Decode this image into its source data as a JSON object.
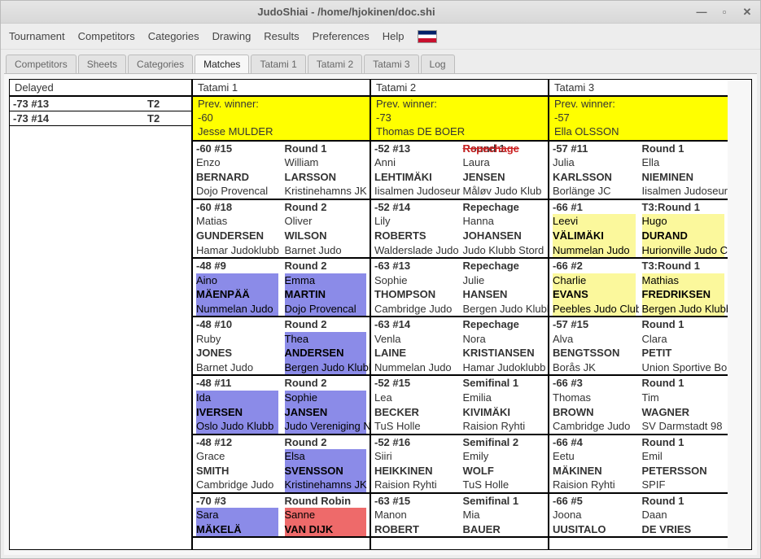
{
  "window": {
    "title": "JudoShiai - /home/hjokinen/doc.shi"
  },
  "menu": [
    "Tournament",
    "Competitors",
    "Categories",
    "Drawing",
    "Results",
    "Preferences",
    "Help"
  ],
  "tabs": [
    "Competitors",
    "Sheets",
    "Categories",
    "Matches",
    "Tatami 1",
    "Tatami 2",
    "Tatami 3",
    "Log"
  ],
  "active_tab": "Matches",
  "headers": {
    "delayed": "Delayed",
    "t1": "Tatami 1",
    "t2": "Tatami 2",
    "t3": "Tatami 3"
  },
  "delayed": [
    {
      "cat": "-73 #13",
      "tatami": "T2"
    },
    {
      "cat": "-73 #14",
      "tatami": "T2"
    }
  ],
  "prev": {
    "label": "Prev. winner:",
    "t1": {
      "cat": "-60",
      "name": "Jesse MULDER"
    },
    "t2": {
      "cat": "-73",
      "name": "Thomas DE BOER"
    },
    "t3": {
      "cat": "-57",
      "name": "Ella OLSSON"
    }
  },
  "t1": [
    {
      "cat": "-60 #15",
      "round": "Round 1",
      "white": {
        "given": "Enzo",
        "family": "BERNARD",
        "club": "Dojo Provencal"
      },
      "blue": {
        "given": "William",
        "family": "LARSSON",
        "club": "Kristinehamns JK"
      }
    },
    {
      "cat": "-60 #18",
      "round": "Round 2",
      "white": {
        "given": "Matias",
        "family": "GUNDERSEN",
        "club": "Hamar Judoklubb"
      },
      "blue": {
        "given": "Oliver",
        "family": "WILSON",
        "club": "Barnet Judo"
      }
    },
    {
      "cat": "-48 #9",
      "round": "Round 2",
      "white": {
        "given": "Aino",
        "family": "MÄENPÄÄ",
        "club": "Nummelan Judo",
        "hl": "blue"
      },
      "blue": {
        "given": "Emma",
        "family": "MARTIN",
        "club": "Dojo Provencal",
        "hl": "blue"
      }
    },
    {
      "cat": "-48 #10",
      "round": "Round 2",
      "white": {
        "given": "Ruby",
        "family": "JONES",
        "club": "Barnet Judo"
      },
      "blue": {
        "given": "Thea",
        "family": "ANDERSEN",
        "club": "Bergen Judo Klubb",
        "hl": "blue"
      }
    },
    {
      "cat": "-48 #11",
      "round": "Round 2",
      "white": {
        "given": "Ida",
        "family": "IVERSEN",
        "club": "Oslo Judo Klubb",
        "hl": "blue"
      },
      "blue": {
        "given": "Sophie",
        "family": "JANSEN",
        "club": "Judo Vereniging N",
        "hl": "blue"
      }
    },
    {
      "cat": "-48 #12",
      "round": "Round 2",
      "white": {
        "given": "Grace",
        "family": "SMITH",
        "club": "Cambridge Judo"
      },
      "blue": {
        "given": "Elsa",
        "family": "SVENSSON",
        "club": "Kristinehamns JK",
        "hl": "blue"
      }
    },
    {
      "cat": "-70 #3",
      "round": "Round Robin",
      "white": {
        "given": "Sara",
        "family": "MÄKELÄ",
        "club": "",
        "hl": "blue"
      },
      "blue": {
        "given": "Sanne",
        "family": "VAN DIJK",
        "club": "",
        "hl": "red"
      }
    }
  ],
  "t2": [
    {
      "cat": "-52 #13",
      "round": "Round 1",
      "round_strike": "Repechage",
      "white": {
        "given": "Anni",
        "family": "LEHTIMÄKI",
        "club": "Iisalmen Judoseur"
      },
      "blue": {
        "given": "Laura",
        "family": "JENSEN",
        "club": "Måløv Judo Klub"
      }
    },
    {
      "cat": "-52 #14",
      "round": "Repechage",
      "white": {
        "given": "Lily",
        "family": "ROBERTS",
        "club": "Walderslade Judo"
      },
      "blue": {
        "given": "Hanna",
        "family": "JOHANSEN",
        "club": "Judo Klubb Stord"
      }
    },
    {
      "cat": "-63 #13",
      "round": "Repechage",
      "white": {
        "given": "Sophie",
        "family": "THOMPSON",
        "club": "Cambridge Judo"
      },
      "blue": {
        "given": "Julie",
        "family": "HANSEN",
        "club": "Bergen Judo Klubb"
      }
    },
    {
      "cat": "-63 #14",
      "round": "Repechage",
      "white": {
        "given": "Venla",
        "family": "LAINE",
        "club": "Nummelan Judo"
      },
      "blue": {
        "given": "Nora",
        "family": "KRISTIANSEN",
        "club": "Hamar Judoklubb"
      }
    },
    {
      "cat": "-52 #15",
      "round": "Semifinal 1",
      "white": {
        "given": "Lea",
        "family": "BECKER",
        "club": "TuS Holle"
      },
      "blue": {
        "given": "Emilia",
        "family": "KIVIMÄKI",
        "club": "Raision Ryhti"
      }
    },
    {
      "cat": "-52 #16",
      "round": "Semifinal 2",
      "white": {
        "given": "Siiri",
        "family": "HEIKKINEN",
        "club": "Raision Ryhti"
      },
      "blue": {
        "given": "Emily",
        "family": "WOLF",
        "club": "TuS Holle"
      }
    },
    {
      "cat": "-63 #15",
      "round": "Semifinal 1",
      "white": {
        "given": "Manon",
        "family": "ROBERT",
        "club": ""
      },
      "blue": {
        "given": "Mia",
        "family": "BAUER",
        "club": ""
      }
    }
  ],
  "t3": [
    {
      "cat": "-57 #11",
      "round": "Round 1",
      "white": {
        "given": "Julia",
        "family": "KARLSSON",
        "club": "Borlänge JC"
      },
      "blue": {
        "given": "Ella",
        "family": "NIEMINEN",
        "club": "Iisalmen Judoseur"
      }
    },
    {
      "cat": "-66 #1",
      "round": "T3:Round 1",
      "white": {
        "given": "Leevi",
        "family": "VÄLIMÄKI",
        "club": "Nummelan Judo",
        "hl": "yellow"
      },
      "blue": {
        "given": "Hugo",
        "family": "DURAND",
        "club": "Hurionville Judo C",
        "hl": "yellow"
      }
    },
    {
      "cat": "-66 #2",
      "round": "T3:Round 1",
      "white": {
        "given": "Charlie",
        "family": "EVANS",
        "club": "Peebles Judo Club",
        "hl": "yellow"
      },
      "blue": {
        "given": "Mathias",
        "family": "FREDRIKSEN",
        "club": "Bergen Judo Klubb",
        "hl": "yellow"
      }
    },
    {
      "cat": "-57 #15",
      "round": "Round 1",
      "white": {
        "given": "Alva",
        "family": "BENGTSSON",
        "club": "Borås JK"
      },
      "blue": {
        "given": "Clara",
        "family": "PETIT",
        "club": "Union Sportive Bo"
      }
    },
    {
      "cat": "-66 #3",
      "round": "Round 1",
      "white": {
        "given": "Thomas",
        "family": "BROWN",
        "club": "Cambridge Judo"
      },
      "blue": {
        "given": "Tim",
        "family": "WAGNER",
        "club": "SV Darmstadt 98"
      }
    },
    {
      "cat": "-66 #4",
      "round": "Round 1",
      "white": {
        "given": "Eetu",
        "family": "MÄKINEN",
        "club": "Raision Ryhti"
      },
      "blue": {
        "given": "Emil",
        "family": "PETERSSON",
        "club": "SPIF"
      }
    },
    {
      "cat": "-66 #5",
      "round": "Round 1",
      "white": {
        "given": "Joona",
        "family": "UUSITALO",
        "club": ""
      },
      "blue": {
        "given": "Daan",
        "family": "DE VRIES",
        "club": ""
      }
    }
  ]
}
